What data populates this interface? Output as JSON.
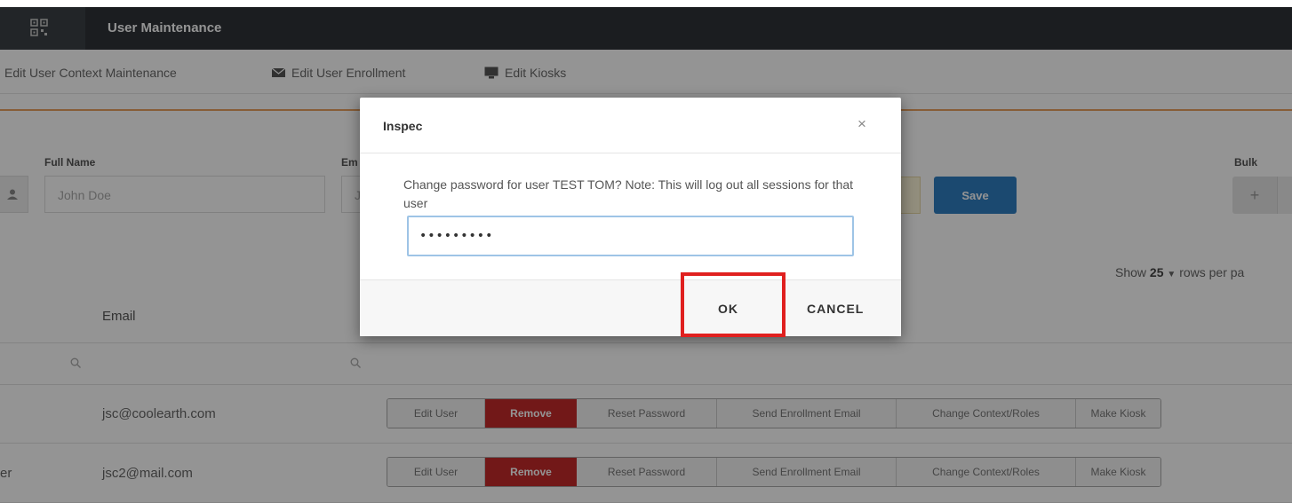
{
  "app": {
    "title": "User Maintenance"
  },
  "tabs": [
    {
      "label": "Edit User Context Maintenance",
      "icon": ""
    },
    {
      "label": "Edit User Enrollment",
      "icon": "envelope-icon"
    },
    {
      "label": "Edit Kiosks",
      "icon": "monitor-icon"
    }
  ],
  "form": {
    "full_name_label": "Full Name",
    "full_name_placeholder": "John Doe",
    "email_label_fragment": "Em",
    "email_placeholder_fragment": "J",
    "save_label": "Save",
    "bulk_label": "Bulk",
    "bulk_add_label": "+"
  },
  "table": {
    "show_prefix": "Show",
    "rows_per_page_value": "25",
    "show_suffix": "rows per pa",
    "email_header": "Email",
    "rows": [
      {
        "name_fragment": "",
        "email": "jsc@coolearth.com"
      },
      {
        "name_fragment": "er",
        "email": "jsc2@mail.com"
      }
    ],
    "row_actions": [
      "Edit User",
      "Remove",
      "Reset Password",
      "Send Enrollment Email",
      "Change Context/Roles",
      "Make Kiosk"
    ]
  },
  "modal": {
    "title": "Inspec",
    "close_glyph": "×",
    "message": "Change password for user TEST TOM? Note: This will log out all sessions for that user",
    "password_value": "•••••••••",
    "ok_label": "OK",
    "cancel_label": "CANCEL"
  },
  "colors": {
    "topbar": "#2f3237",
    "accent_blue": "#2f7ec2",
    "remove_red": "#c52a2a",
    "highlight_red": "#e0201f",
    "orange_rule": "#e8a160"
  }
}
